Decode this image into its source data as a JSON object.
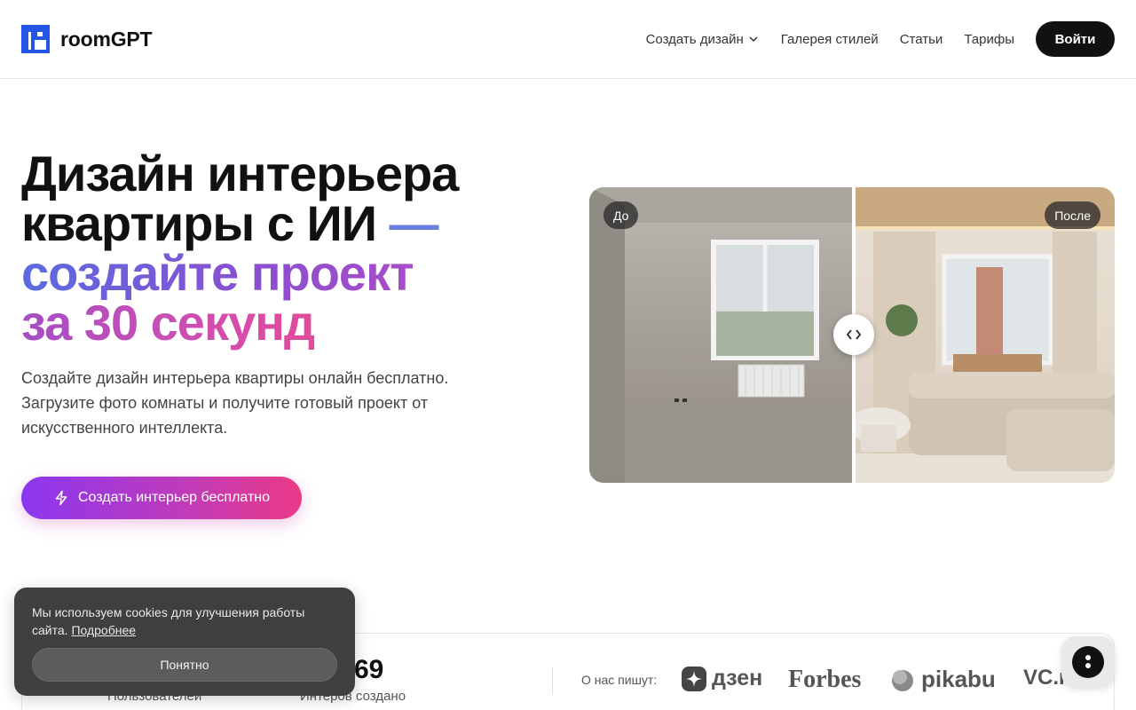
{
  "brand": {
    "name": "roomGPT"
  },
  "nav": {
    "items": [
      {
        "label": "Создать дизайн",
        "has_dropdown": true
      },
      {
        "label": "Галерея стилей"
      },
      {
        "label": "Статьи"
      },
      {
        "label": "Тарифы"
      }
    ],
    "login_label": "Войти"
  },
  "hero": {
    "title_line1": "Дизайн интерьера",
    "title_line2": "квартиры с ИИ",
    "title_dash": "—",
    "title_line3": "создайте проект",
    "title_line4": "за 30 секунд",
    "subtitle": "Создайте дизайн интерьера квартиры онлайн бесплатно. Загрузите фото комнаты и получите готовый проект от искусственного интеллекта.",
    "cta_label": "Создать интерьер бесплатно",
    "cta_icon": "lightning-icon"
  },
  "compare": {
    "before_label": "До",
    "after_label": "После"
  },
  "stats": {
    "users_label": "Пользователей",
    "interiors_value": "69",
    "interiors_label": "Интеров создано",
    "press_label": "О нас пишут:",
    "press": [
      "дзен",
      "Forbes",
      "pikabu",
      "VC.ru"
    ]
  },
  "cookie": {
    "text": "Мы используем cookies для улучшения работы сайта.",
    "link_label": "Подробнее",
    "button_label": "Понятно"
  },
  "colors": {
    "accent_start": "#8a37f0",
    "accent_end": "#ea3a86",
    "title_blue": "#5b6be0",
    "dark": "#111111"
  }
}
